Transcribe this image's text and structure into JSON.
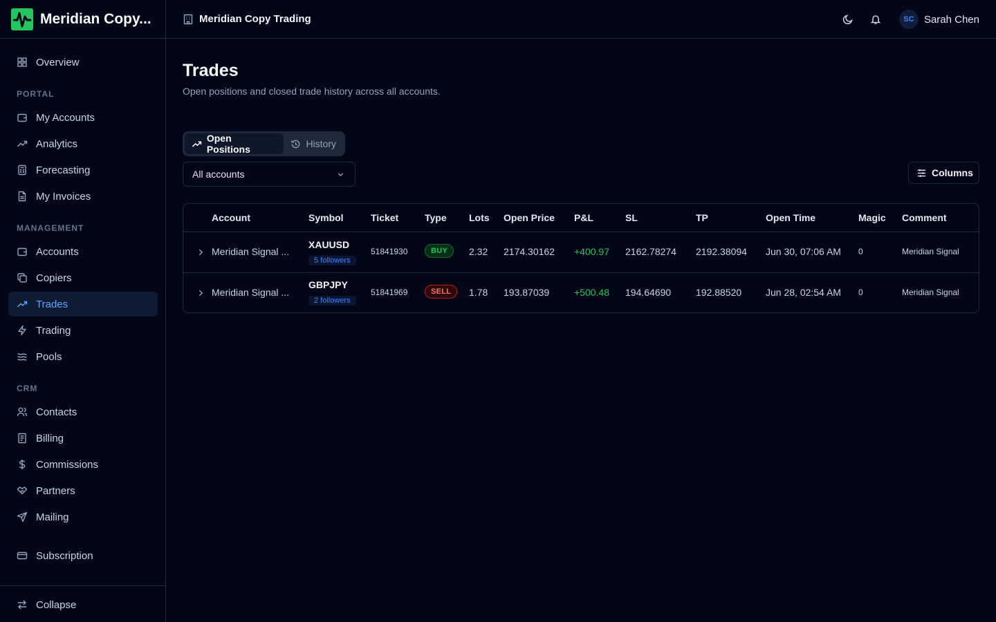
{
  "brand": {
    "name": "Meridian Copy..."
  },
  "header": {
    "org_name": "Meridian Copy Trading",
    "user_initials": "SC",
    "user_name": "Sarah Chen"
  },
  "sidebar": {
    "overview": "Overview",
    "sections": {
      "portal": "PORTAL",
      "management": "MANAGEMENT",
      "crm": "CRM"
    },
    "portal_items": [
      {
        "label": "My Accounts",
        "icon": "wallet-icon"
      },
      {
        "label": "Analytics",
        "icon": "trend-icon"
      },
      {
        "label": "Forecasting",
        "icon": "calculator-icon"
      },
      {
        "label": "My Invoices",
        "icon": "file-icon"
      }
    ],
    "management_items": [
      {
        "label": "Accounts",
        "icon": "wallet-icon"
      },
      {
        "label": "Copiers",
        "icon": "copy-icon"
      },
      {
        "label": "Trades",
        "icon": "trend-icon",
        "active": true
      },
      {
        "label": "Trading",
        "icon": "bolt-icon"
      },
      {
        "label": "Pools",
        "icon": "waves-icon"
      }
    ],
    "crm_items": [
      {
        "label": "Contacts",
        "icon": "users-icon"
      },
      {
        "label": "Billing",
        "icon": "receipt-icon"
      },
      {
        "label": "Commissions",
        "icon": "dollar-icon"
      },
      {
        "label": "Partners",
        "icon": "handshake-icon"
      },
      {
        "label": "Mailing",
        "icon": "send-icon"
      }
    ],
    "subscription": "Subscription",
    "collapse": "Collapse"
  },
  "page": {
    "title": "Trades",
    "subtitle": "Open positions and closed trade history across all accounts."
  },
  "tabs": {
    "open_positions": "Open Positions",
    "history": "History"
  },
  "account_filter": {
    "value": "All accounts"
  },
  "columns_button": "Columns",
  "table": {
    "headers": {
      "account": "Account",
      "symbol": "Symbol",
      "ticket": "Ticket",
      "type": "Type",
      "lots": "Lots",
      "open_price": "Open Price",
      "pnl": "P&L",
      "sl": "SL",
      "tp": "TP",
      "open_time": "Open Time",
      "magic": "Magic",
      "comment": "Comment"
    },
    "rows": [
      {
        "account": "Meridian Signal ...",
        "symbol": "XAUUSD",
        "followers": "5 followers",
        "ticket": "51841930",
        "type": "BUY",
        "lots": "2.32",
        "open_price": "2174.30162",
        "pnl": "+400.97",
        "sl": "2162.78274",
        "tp": "2192.38094",
        "open_time": "Jun 30, 07:06 AM",
        "magic": "0",
        "comment": "Meridian Signal"
      },
      {
        "account": "Meridian Signal ...",
        "symbol": "GBPJPY",
        "followers": "2 followers",
        "ticket": "51841969",
        "type": "SELL",
        "lots": "1.78",
        "open_price": "193.87039",
        "pnl": "+500.48",
        "sl": "194.64690",
        "tp": "192.88520",
        "open_time": "Jun 28, 02:54 AM",
        "magic": "0",
        "comment": "Meridian Signal"
      }
    ]
  },
  "colors": {
    "accent": "#3b82f6",
    "buy": "#22c55e",
    "sell": "#f87171",
    "background": "#020617"
  }
}
